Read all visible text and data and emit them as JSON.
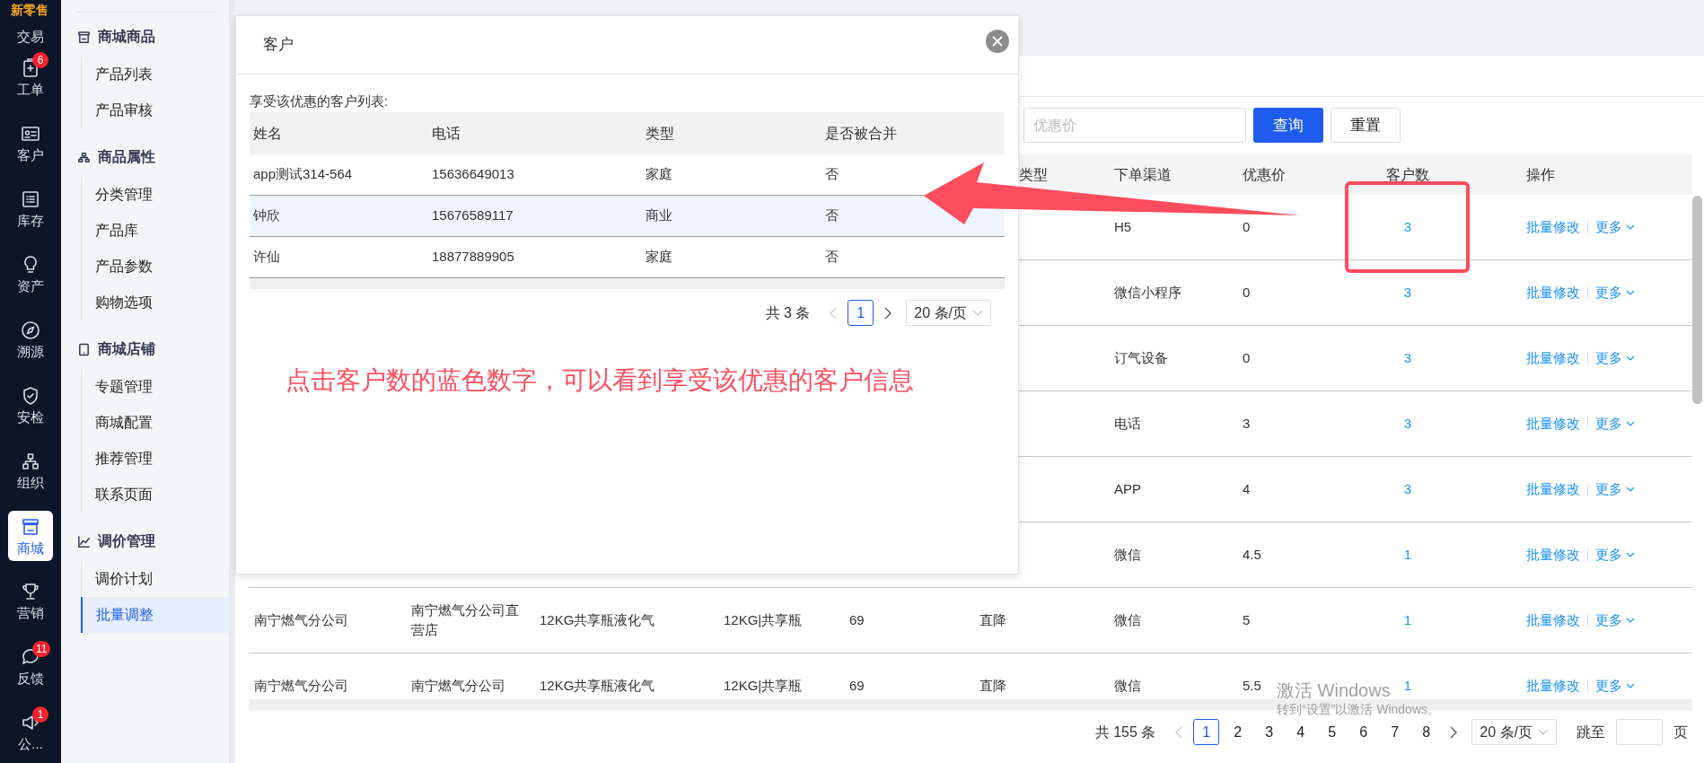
{
  "logo": "新零售",
  "rail": [
    {
      "label": "交易",
      "selected": false
    },
    {
      "label": "工单",
      "selected": false,
      "badge": "6"
    },
    {
      "label": "客户",
      "selected": false
    },
    {
      "label": "库存",
      "selected": false
    },
    {
      "label": "资产",
      "selected": false
    },
    {
      "label": "溯源",
      "selected": false
    },
    {
      "label": "安检",
      "selected": false
    },
    {
      "label": "组织",
      "selected": false
    },
    {
      "label": "商城",
      "selected": true
    },
    {
      "label": "营销",
      "selected": false
    },
    {
      "label": "反馈",
      "selected": false,
      "badge": "11"
    },
    {
      "label": "公...",
      "selected": false,
      "badge": "1"
    }
  ],
  "submenu": [
    {
      "title": "商城商品",
      "items": [
        {
          "label": "产品列表",
          "selected": false
        },
        {
          "label": "产品审核",
          "selected": false
        }
      ]
    },
    {
      "title": "商品属性",
      "items": [
        {
          "label": "分类管理",
          "selected": false
        },
        {
          "label": "产品库",
          "selected": false
        },
        {
          "label": "产品参数",
          "selected": false
        },
        {
          "label": "购物选项",
          "selected": false
        }
      ]
    },
    {
      "title": "商城店铺",
      "items": [
        {
          "label": "专题管理",
          "selected": false
        },
        {
          "label": "商城配置",
          "selected": false
        },
        {
          "label": "推荐管理",
          "selected": false
        },
        {
          "label": "联系页面",
          "selected": false
        }
      ]
    },
    {
      "title": "调价管理",
      "items": [
        {
          "label": "调价计划",
          "selected": false
        },
        {
          "label": "批量调整",
          "selected": true
        }
      ]
    }
  ],
  "filters": {
    "placeholder": "优惠价",
    "buttons": [
      "查询",
      "重置"
    ]
  },
  "table": {
    "columns": [
      "",
      "",
      "",
      "",
      "",
      "类型",
      "下单渠道",
      "优惠价",
      "客户数",
      "操作"
    ],
    "rows": [
      {
        "cells": [
          "",
          "",
          "",
          "",
          "",
          "",
          "H5",
          "0",
          "3"
        ],
        "actions": [
          "批量修改",
          "更多"
        ]
      },
      {
        "cells": [
          "",
          "",
          "",
          "",
          "",
          "",
          "微信小程序",
          "0",
          "3"
        ],
        "actions": [
          "批量修改",
          "更多"
        ]
      },
      {
        "cells": [
          "",
          "",
          "",
          "",
          "",
          "",
          "订气设备",
          "0",
          "3"
        ],
        "actions": [
          "批量修改",
          "更多"
        ]
      },
      {
        "cells": [
          "",
          "",
          "",
          "",
          "",
          "",
          "电话",
          "3",
          "3"
        ],
        "actions": [
          "批量修改",
          "更多"
        ]
      },
      {
        "cells": [
          "",
          "",
          "",
          "",
          "",
          "",
          "APP",
          "4",
          "3"
        ],
        "actions": [
          "批量修改",
          "更多"
        ]
      },
      {
        "cells": [
          "",
          "",
          "",
          "",
          "",
          "",
          "微信",
          "4.5",
          "1"
        ],
        "actions": [
          "批量修改",
          "更多"
        ]
      },
      {
        "cells": [
          "南宁燃气分公司",
          "南宁燃气分公司直营店",
          "12KG共享瓶液化气",
          "12KG|共享瓶",
          "69",
          "直降",
          "微信",
          "5",
          "1"
        ],
        "actions": [
          "批量修改",
          "更多"
        ]
      },
      {
        "cells": [
          "南宁燃气分公司",
          "南宁燃气分公司",
          "12KG共享瓶液化气",
          "12KG|共享瓶",
          "69",
          "直降",
          "微信",
          "5.5",
          "1"
        ],
        "actions": [
          "批量修改",
          "更多"
        ]
      }
    ]
  },
  "pagination": {
    "total": "共 155 条",
    "pages": [
      {
        "label": "1",
        "selected": true
      },
      {
        "label": "2",
        "selected": false
      },
      {
        "label": "3",
        "selected": false
      },
      {
        "label": "4",
        "selected": false
      },
      {
        "label": "5",
        "selected": false
      },
      {
        "label": "6",
        "selected": false
      },
      {
        "label": "7",
        "selected": false
      },
      {
        "label": "8",
        "selected": false
      }
    ],
    "page_size": "20 条/页",
    "jump_label": "跳至",
    "page_suffix": "页"
  },
  "modal": {
    "title": "客户",
    "subtitle": "享受该优惠的客户列表:",
    "columns": [
      "姓名",
      "电话",
      "类型",
      "是否被合并"
    ],
    "rows": [
      {
        "cells": [
          "app测试314-564",
          "15636649013",
          "家庭",
          "否"
        ],
        "selected": false
      },
      {
        "cells": [
          "钟欣",
          "15676589117",
          "商业",
          "否"
        ],
        "selected": true
      },
      {
        "cells": [
          "许仙",
          "18877889905",
          "家庭",
          "否"
        ],
        "selected": false
      }
    ],
    "pagination": {
      "total": "共 3 条",
      "pages": [
        {
          "label": "1",
          "selected": true
        }
      ],
      "page_size": "20 条/页"
    }
  },
  "annotation": "点击客户数的蓝色数字，可以看到享受该优惠的客户信息",
  "os_notice": {
    "title": "激活 Windows",
    "text": "转到“设置”以激活 Windows。"
  }
}
